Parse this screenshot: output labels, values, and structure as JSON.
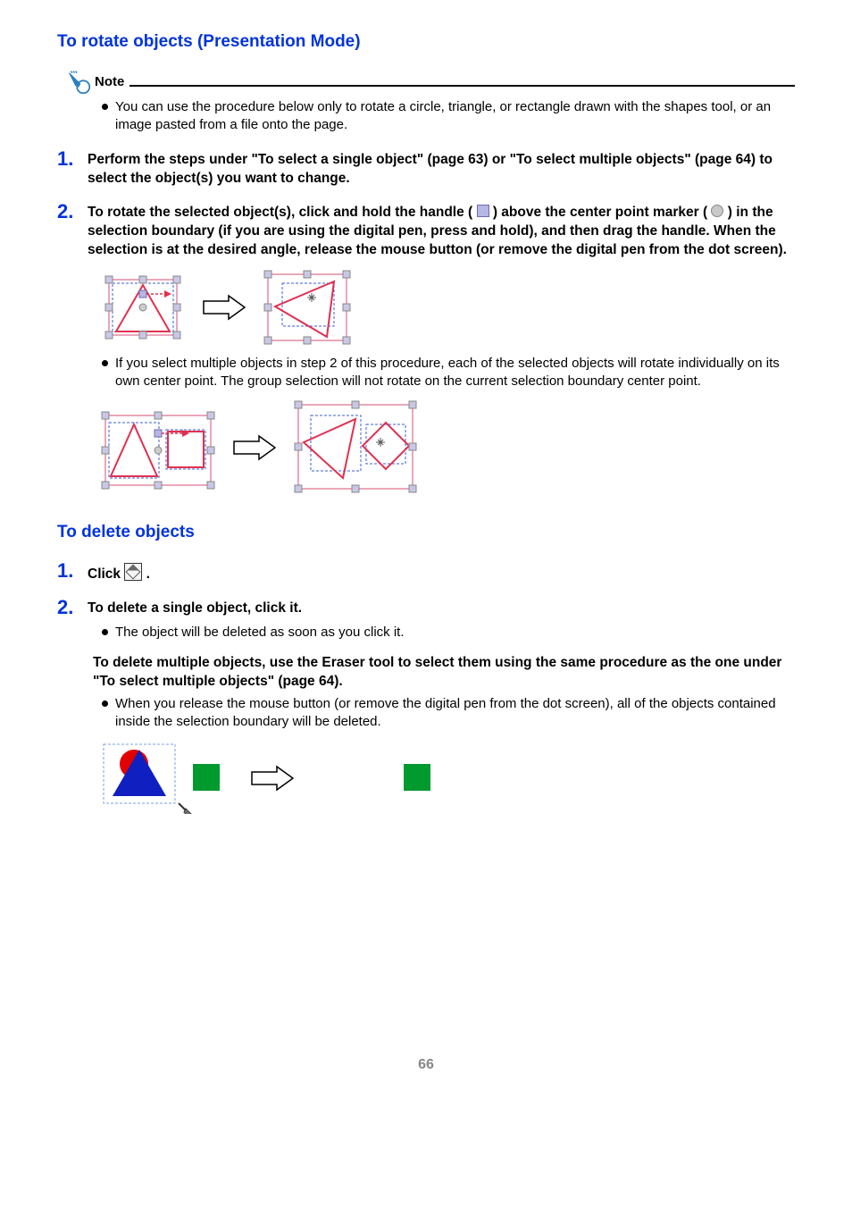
{
  "section1": {
    "title": "To rotate objects (Presentation Mode)",
    "note_label": "Note",
    "note_bullet": "You can use the procedure below only to rotate a circle, triangle, or rectangle drawn with the shapes tool, or an image pasted from a file onto the page.",
    "step1_num": "1.",
    "step1_text": "Perform the steps under \"To select a single object\" (page 63) or \"To select multiple objects\" (page 64) to select the object(s) you want to change.",
    "step2_num": "2.",
    "step2_part1": "To rotate the selected object(s), click and hold the handle (",
    "step2_part2": ") above the center point marker (",
    "step2_part3": ") in the selection boundary (if you are using the digital pen, press and hold), and then drag the handle. When the selection is at the desired angle, release the mouse button (or remove the digital pen from the dot screen).",
    "step2_note": "If you select multiple objects in step 2 of this procedure, each of the selected objects will rotate individually on its own center point. The group selection will not rotate on the current selection boundary center point."
  },
  "section2": {
    "title": "To delete objects",
    "step1_num": "1.",
    "step1_part1": "Click ",
    "step1_part2": ".",
    "step2_num": "2.",
    "step2_text": "To delete a single object, click it.",
    "step2_bullet": "The object will be deleted as soon as you click it.",
    "multi_heading": "To delete multiple objects, use the Eraser tool to select them using the same procedure as the one under \"To select multiple objects\" (page 64).",
    "multi_bullet": "When you release the mouse button (or remove the digital pen from the dot screen), all of the objects contained inside the selection boundary will be deleted."
  },
  "page_number": "66"
}
